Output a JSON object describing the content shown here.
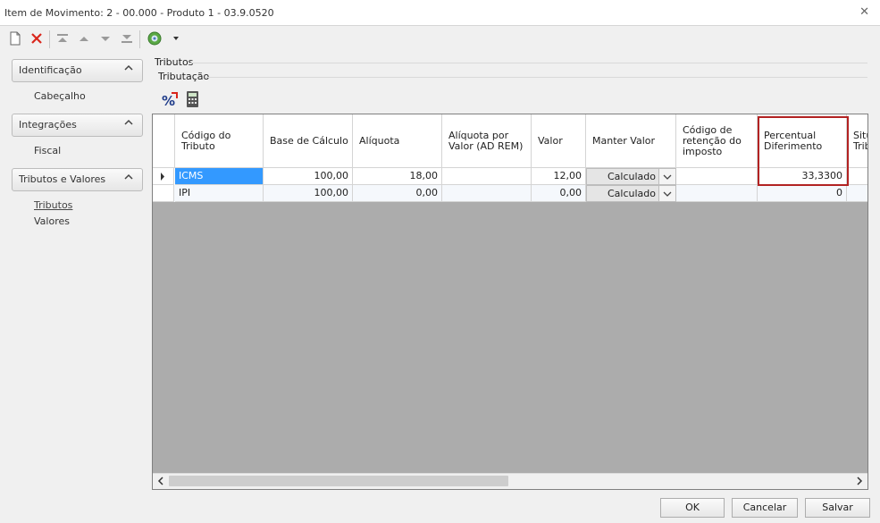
{
  "window": {
    "title": "Item de Movimento: 2 - 00.000 - Produto 1 - 03.9.0520"
  },
  "sidebar": {
    "groups": [
      {
        "label": "Identificação",
        "items": [
          "Cabeçalho"
        ]
      },
      {
        "label": "Integrações",
        "items": [
          "Fiscal"
        ]
      },
      {
        "label": "Tributos e Valores",
        "items": [
          "Tributos",
          "Valores"
        ]
      }
    ]
  },
  "main": {
    "section": "Tributos",
    "subsection": "Tributação",
    "grid": {
      "columns": [
        "Código do Tributo",
        "Base de Cálculo",
        "Alíquota",
        "Alíquota por Valor (AD REM)",
        "Valor",
        "Manter Valor",
        "Código de retenção do imposto",
        "Percentual Diferimento",
        "Situ Trib"
      ],
      "rows": [
        {
          "codigo": "ICMS",
          "base": "100,00",
          "aliquota": "18,00",
          "ad_rem": "",
          "valor": "12,00",
          "manter": "Calculado",
          "retencao": "",
          "diferimento": "33,3300"
        },
        {
          "codigo": "IPI",
          "base": "100,00",
          "aliquota": "0,00",
          "ad_rem": "",
          "valor": "0,00",
          "manter": "Calculado",
          "retencao": "",
          "diferimento": "0"
        }
      ]
    }
  },
  "buttons": {
    "ok": "OK",
    "cancel": "Cancelar",
    "save": "Salvar"
  },
  "colors": {
    "selection": "#3399ff",
    "highlight": "#b22222",
    "grid_background": "#acacac"
  }
}
